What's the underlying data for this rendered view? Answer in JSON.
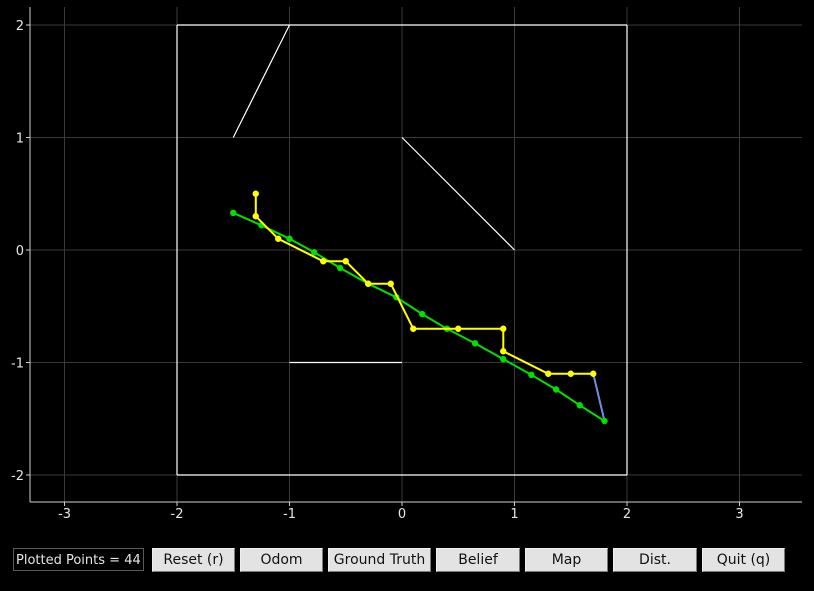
{
  "plot": {
    "x_ticks": [
      "-3",
      "-2",
      "-1",
      "0",
      "1",
      "2",
      "3"
    ],
    "y_ticks": [
      "2",
      "1",
      "0",
      "-1",
      "-2"
    ],
    "xlim": [
      -3.3,
      3.5
    ],
    "ylim": [
      -2.25,
      2.1
    ],
    "grid": true,
    "colors": {
      "background": "#000000",
      "grid": "#3a3a3a",
      "map": "#ffffff",
      "ground_truth": "#00e000",
      "belief": "#ffff00",
      "odom_connector": "#6f8fe0"
    },
    "map_segments": [
      [
        [
          -2,
          2
        ],
        [
          2,
          2
        ]
      ],
      [
        [
          2,
          2
        ],
        [
          2,
          -2
        ]
      ],
      [
        [
          2,
          -2
        ],
        [
          -2,
          -2
        ]
      ],
      [
        [
          -2,
          -2
        ],
        [
          -2,
          2
        ]
      ],
      [
        [
          -1.5,
          1
        ],
        [
          -1,
          2
        ]
      ],
      [
        [
          0,
          1
        ],
        [
          1,
          0
        ]
      ],
      [
        [
          -1,
          -1
        ],
        [
          0,
          -1
        ]
      ]
    ],
    "ground_truth": [
      [
        -1.5,
        0.33
      ],
      [
        -1.25,
        0.22
      ],
      [
        -1.0,
        0.1
      ],
      [
        -0.78,
        -0.02
      ],
      [
        -0.55,
        -0.16
      ],
      [
        -0.3,
        -0.3
      ],
      [
        -0.05,
        -0.42
      ],
      [
        0.18,
        -0.57
      ],
      [
        0.4,
        -0.7
      ],
      [
        0.65,
        -0.83
      ],
      [
        0.9,
        -0.97
      ],
      [
        1.15,
        -1.11
      ],
      [
        1.37,
        -1.24
      ],
      [
        1.58,
        -1.38
      ],
      [
        1.8,
        -1.52
      ]
    ],
    "belief": [
      [
        -1.3,
        0.5
      ],
      [
        -1.3,
        0.3
      ],
      [
        -1.1,
        0.1
      ],
      [
        -0.7,
        -0.1
      ],
      [
        -0.5,
        -0.1
      ],
      [
        -0.3,
        -0.3
      ],
      [
        -0.1,
        -0.3
      ],
      [
        0.1,
        -0.7
      ],
      [
        0.5,
        -0.7
      ],
      [
        0.9,
        -0.7
      ],
      [
        0.9,
        -0.9
      ],
      [
        1.3,
        -1.1
      ],
      [
        1.5,
        -1.1
      ],
      [
        1.7,
        -1.1
      ]
    ],
    "odom_connector": [
      [
        1.7,
        -1.1
      ],
      [
        1.8,
        -1.52
      ]
    ]
  },
  "controls": {
    "counter": "Plotted Points = 44",
    "buttons": [
      {
        "label": "Reset (r)"
      },
      {
        "label": "Odom"
      },
      {
        "label": "Ground Truth"
      },
      {
        "label": "Belief"
      },
      {
        "label": "Map"
      },
      {
        "label": "Dist."
      },
      {
        "label": "Quit (q)"
      }
    ]
  }
}
